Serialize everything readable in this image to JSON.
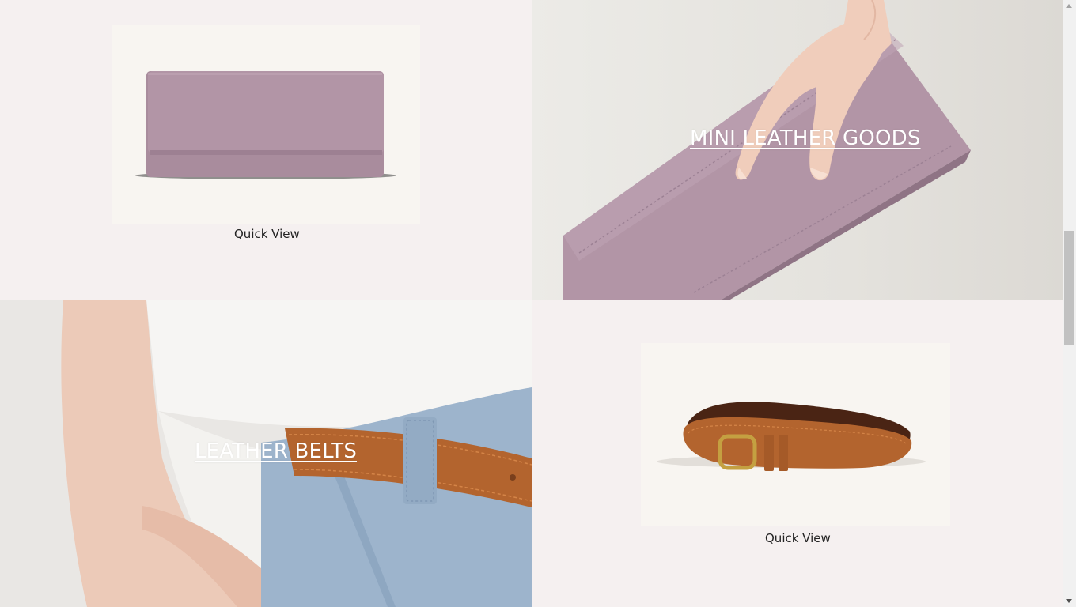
{
  "products": [
    {
      "id": "wallet",
      "quick_view_label": "Quick View"
    },
    {
      "id": "belt",
      "quick_view_label": "Quick View"
    }
  ],
  "categories": [
    {
      "id": "mini-leather-goods",
      "label": "MINI LEATHER GOODS"
    },
    {
      "id": "leather-belts",
      "label": "LEATHER BELTS"
    }
  ],
  "colors": {
    "page_bg": "#f5f0f0",
    "wallet_lilac": "#b295a6",
    "belt_tan": "#b3642e",
    "denim": "#9db4cc"
  }
}
